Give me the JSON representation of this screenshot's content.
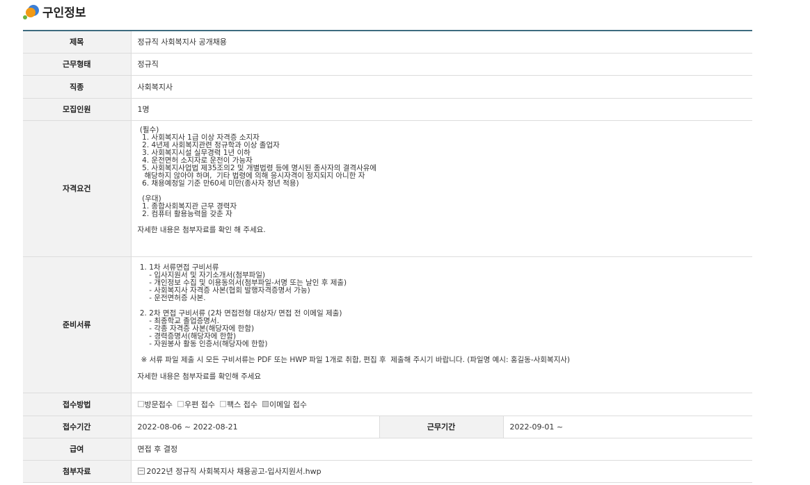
{
  "section": {
    "title": "구인정보"
  },
  "rows": {
    "title": {
      "label": "제목",
      "value": "정규직 사회복지사 공개채용"
    },
    "work_type": {
      "label": "근무형태",
      "value": "정규직"
    },
    "job": {
      "label": "직종",
      "value": "사회복지사"
    },
    "headcount": {
      "label": "모집인원",
      "value": "1명"
    },
    "qualifications": {
      "label": "자격요건",
      "body": " (필수)\n  1. 사회복지사 1급 이상 자격증 소지자\n  2. 4년제 사회복지관련 정규학과 이상 졸업자\n  3. 사회복지시설 실무경력 1년 이하\n  4. 운전면허 소지자로 운전이 가능자\n  5. 사회복지사업법 제35조의2 및 개별법령 등에 명시된 종사자의 결격사유에\n   해당하지 않아야 하며,  기타 법령에 의해 응시자격이 정지되지 아니한 자\n  6. 채용예정일 기준 만60세 미만(종사자 정년 적용)\n\n  (우대)\n  1. 종합사회복지관 근무 경력자\n  2. 컴퓨터 활용능력을 갖춘 자",
      "note": "자세한 내용은 첨부자료를 확인 해 주세요."
    },
    "documents": {
      "label": "준비서류",
      "body": " 1. 1차 서류면접 구비서류\n     - 입사지원서 및 자기소개서(첨부파일)\n     - 개인정보 수집 및 이용동의서(첨부파일-서명 또는 날인 후 제출)\n     - 사회복지사 자격증 사본(협회 발행자격증명서 가능)\n     - 운전면허증 사본.\n\n 2. 2차 면접 구비서류 (2차 면접전형 대상자/ 면접 전 이메일 제출)\n     - 최종학교 졸업증명서.\n     - 각종 자격증 사본(해당자에 한함)\n     - 경력증명서(해당자에 한함)\n     - 자원봉사 활동 인증서(해당자에 한함)",
      "notice": "※ 서류 파일 제출 시 모든 구비서류는 PDF 또는 HWP 파일 1개로 취합, 편집 후  제출해 주시기 바랍니다. (파일명 예시: 홍길동-사회복지사)",
      "note": "자세한 내용은 첨부자료를 확인해 주세요"
    },
    "apply_method": {
      "label": "접수방법",
      "options": [
        {
          "label": "방문접수",
          "checked": false
        },
        {
          "label": "우편 접수",
          "checked": false
        },
        {
          "label": "팩스 접수",
          "checked": false
        },
        {
          "label": "이메일 접수",
          "checked": true
        }
      ]
    },
    "apply_period": {
      "label": "접수기간",
      "value": "2022-08-06 ~ 2022-08-21"
    },
    "work_period": {
      "label": "근무기간",
      "value": "2022-09-01 ~"
    },
    "salary": {
      "label": "급여",
      "value": "면접 후 결정"
    },
    "attachment": {
      "label": "첨부자료",
      "value": "2022년 정규직 사회복지사 채용공고-입사지원서.hwp"
    }
  }
}
